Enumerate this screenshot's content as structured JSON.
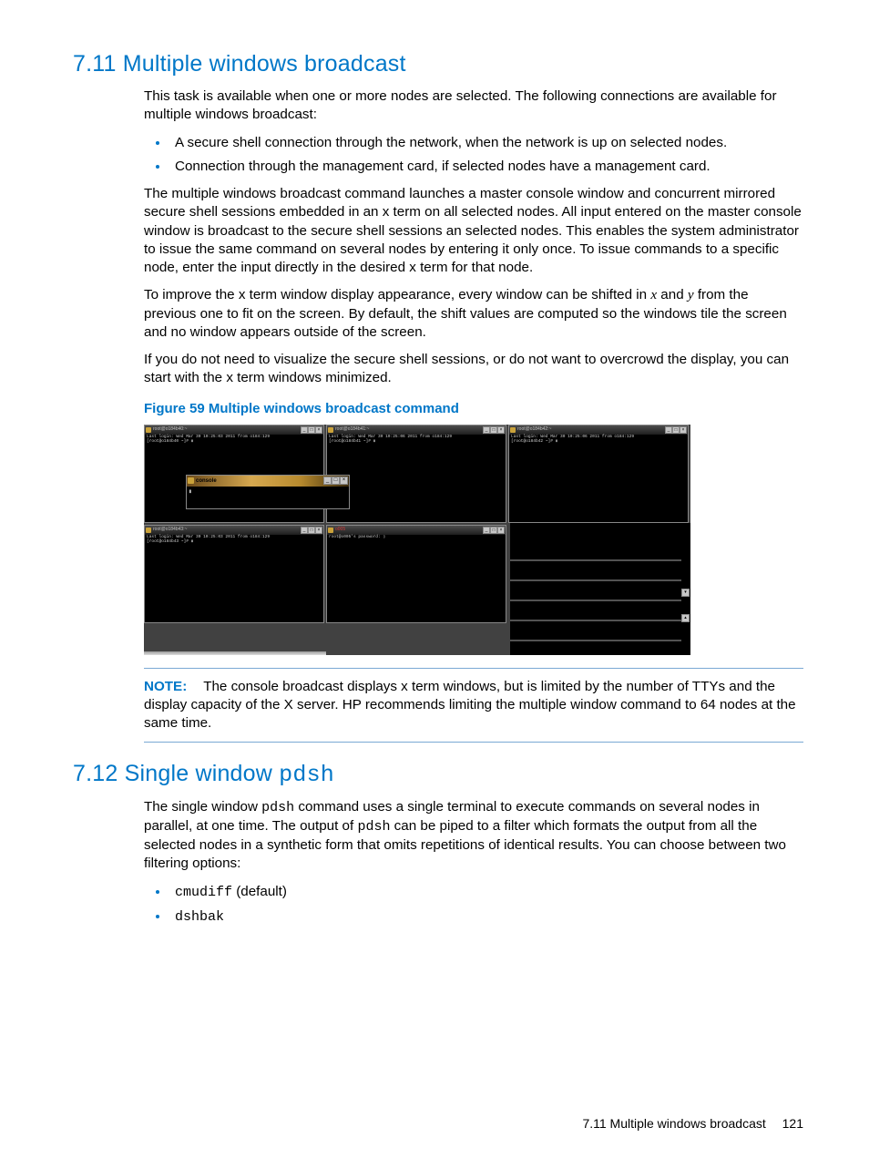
{
  "section711": {
    "heading": "7.11 Multiple windows broadcast",
    "p1": "This task is available when one or more nodes are selected. The following connections are available for multiple windows broadcast:",
    "bullet1": "A secure shell connection through the network, when the network is up on selected nodes.",
    "bullet2": "Connection through the management card, if selected nodes have a management card.",
    "p2": "The multiple windows broadcast command launches a master console window and concurrent mirrored secure shell sessions embedded in an x term on all selected nodes. All input entered on the master console window is broadcast to the secure shell sessions an selected nodes. This enables the system administrator to issue the same command on several nodes by entering it only once. To issue commands to a specific node, enter the input directly in the desired x term for that node.",
    "p3a": "To improve the x term window display appearance, every window can be shifted in ",
    "p3b": " and ",
    "p3c": " from the previous one to fit on the screen. By default, the shift values are computed so the windows tile the screen and no window appears outside of the screen.",
    "var_x": "x",
    "var_y": "y",
    "p4": "If you do not need to visualize the secure shell sessions, or do not want to overcrowd the display, you can start with the x term windows minimized.",
    "figcaption": "Figure 59 Multiple windows broadcast command"
  },
  "figure": {
    "title1": "root@o184b40:~",
    "title2": "root@o184b41:~",
    "title3": "root@o184b42:~",
    "title4": "root@o184b43:~",
    "title5": "o005",
    "console_title": "console",
    "line1": "Last login: Wed Mar 30 10:25:03 2011 from o184:129\n[root@o184b40 ~]# ▮",
    "line2": "Last login: Wed Mar 30 10:25:06 2011 from o184:129\n[root@o184b41 ~]# ▮",
    "line3": "Last login: Wed Mar 30 10:25:06 2011 from o184:129\n[root@o184b42 ~]# ▮",
    "line4": "Last login: Wed Mar 30 10:25:03 2011 from o184:129\n[root@o184b43 ~]# ▮",
    "line5": "root@o005's password: ▯",
    "cursor": "▮"
  },
  "note": {
    "label": "NOTE:",
    "text": "The console broadcast displays x term windows, but is limited by the number of TTYs and the display capacity of the X server. HP recommends limiting the multiple window command to 64 nodes at the same time."
  },
  "section712": {
    "heading_pre": "7.12 Single window ",
    "heading_mono": "pdsh",
    "p1a": "The single window ",
    "p1b": " command uses a single terminal to execute commands on several nodes in parallel, at one time. The output of ",
    "p1c": " can be piped to a filter which formats the output from all the selected nodes in a synthetic form that omits repetitions of identical results. You can choose between two filtering options:",
    "mono_pdsh": "pdsh",
    "bullet1_mono": "cmudiff",
    "bullet1_rest": " (default)",
    "bullet2_mono": "dshbak"
  },
  "footer": {
    "text": "7.11 Multiple windows broadcast",
    "page": "121"
  }
}
